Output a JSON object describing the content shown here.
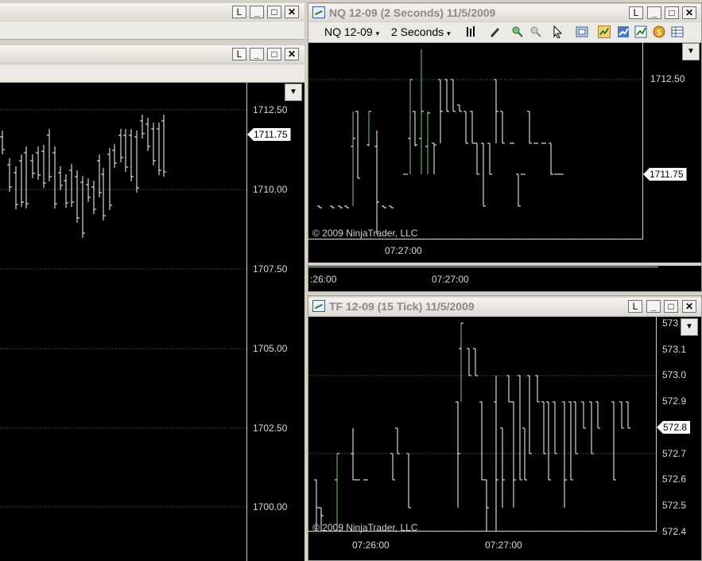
{
  "left_window_top": {
    "title": "",
    "min": "_",
    "max": "□",
    "close": "✕",
    "link": "L"
  },
  "left_window": {
    "title": "",
    "min": "_",
    "max": "□",
    "close": "✕",
    "link": "L",
    "dropdown": "▼",
    "price_labels": [
      "1712.50",
      "1710.00",
      "1707.50",
      "1705.00",
      "1702.50",
      "1700.00"
    ],
    "current_price": "1711.75"
  },
  "nq_window": {
    "title": "NQ 12-09 (2 Seconds)  11/5/2009",
    "link": "L",
    "min": "_",
    "max": "□",
    "close": "✕",
    "instrument": "NQ 12-09",
    "interval": "2 Seconds",
    "dropdown": "▼",
    "price_labels": [
      "1712.50"
    ],
    "current_price": "1711.75",
    "time_labels": [
      "07:27:00"
    ],
    "copyright": "© 2009 NinjaTrader, LLC",
    "lower_time_labels": [
      ":26:00",
      "07:27:00"
    ]
  },
  "tf_window": {
    "title": "TF 12-09 (15 Tick)  11/5/2009",
    "link": "L",
    "min": "_",
    "max": "□",
    "close": "✕",
    "dropdown": "▼",
    "price_labels": [
      "573",
      "573.1",
      "573.0",
      "572.9",
      "572.7",
      "572.6",
      "572.5",
      "572.4"
    ],
    "current_price": "572.8",
    "time_labels": [
      "07:26:00",
      "07:27:00"
    ],
    "copyright": "© 2009 NinjaTrader, LLC"
  },
  "icons": {
    "app": "ninjatrader-chart-icon",
    "bar_type": "bar-type-icon",
    "draw": "pencil-icon",
    "zoom_in": "zoom-in-icon",
    "zoom_out": "zoom-out-icon",
    "cursor": "cursor-icon",
    "data_box": "data-box-icon",
    "strategies": "strategies-icon",
    "indicators": "indicators-icon",
    "properties": "properties-icon",
    "currency": "currency-icon",
    "table": "table-icon"
  }
}
